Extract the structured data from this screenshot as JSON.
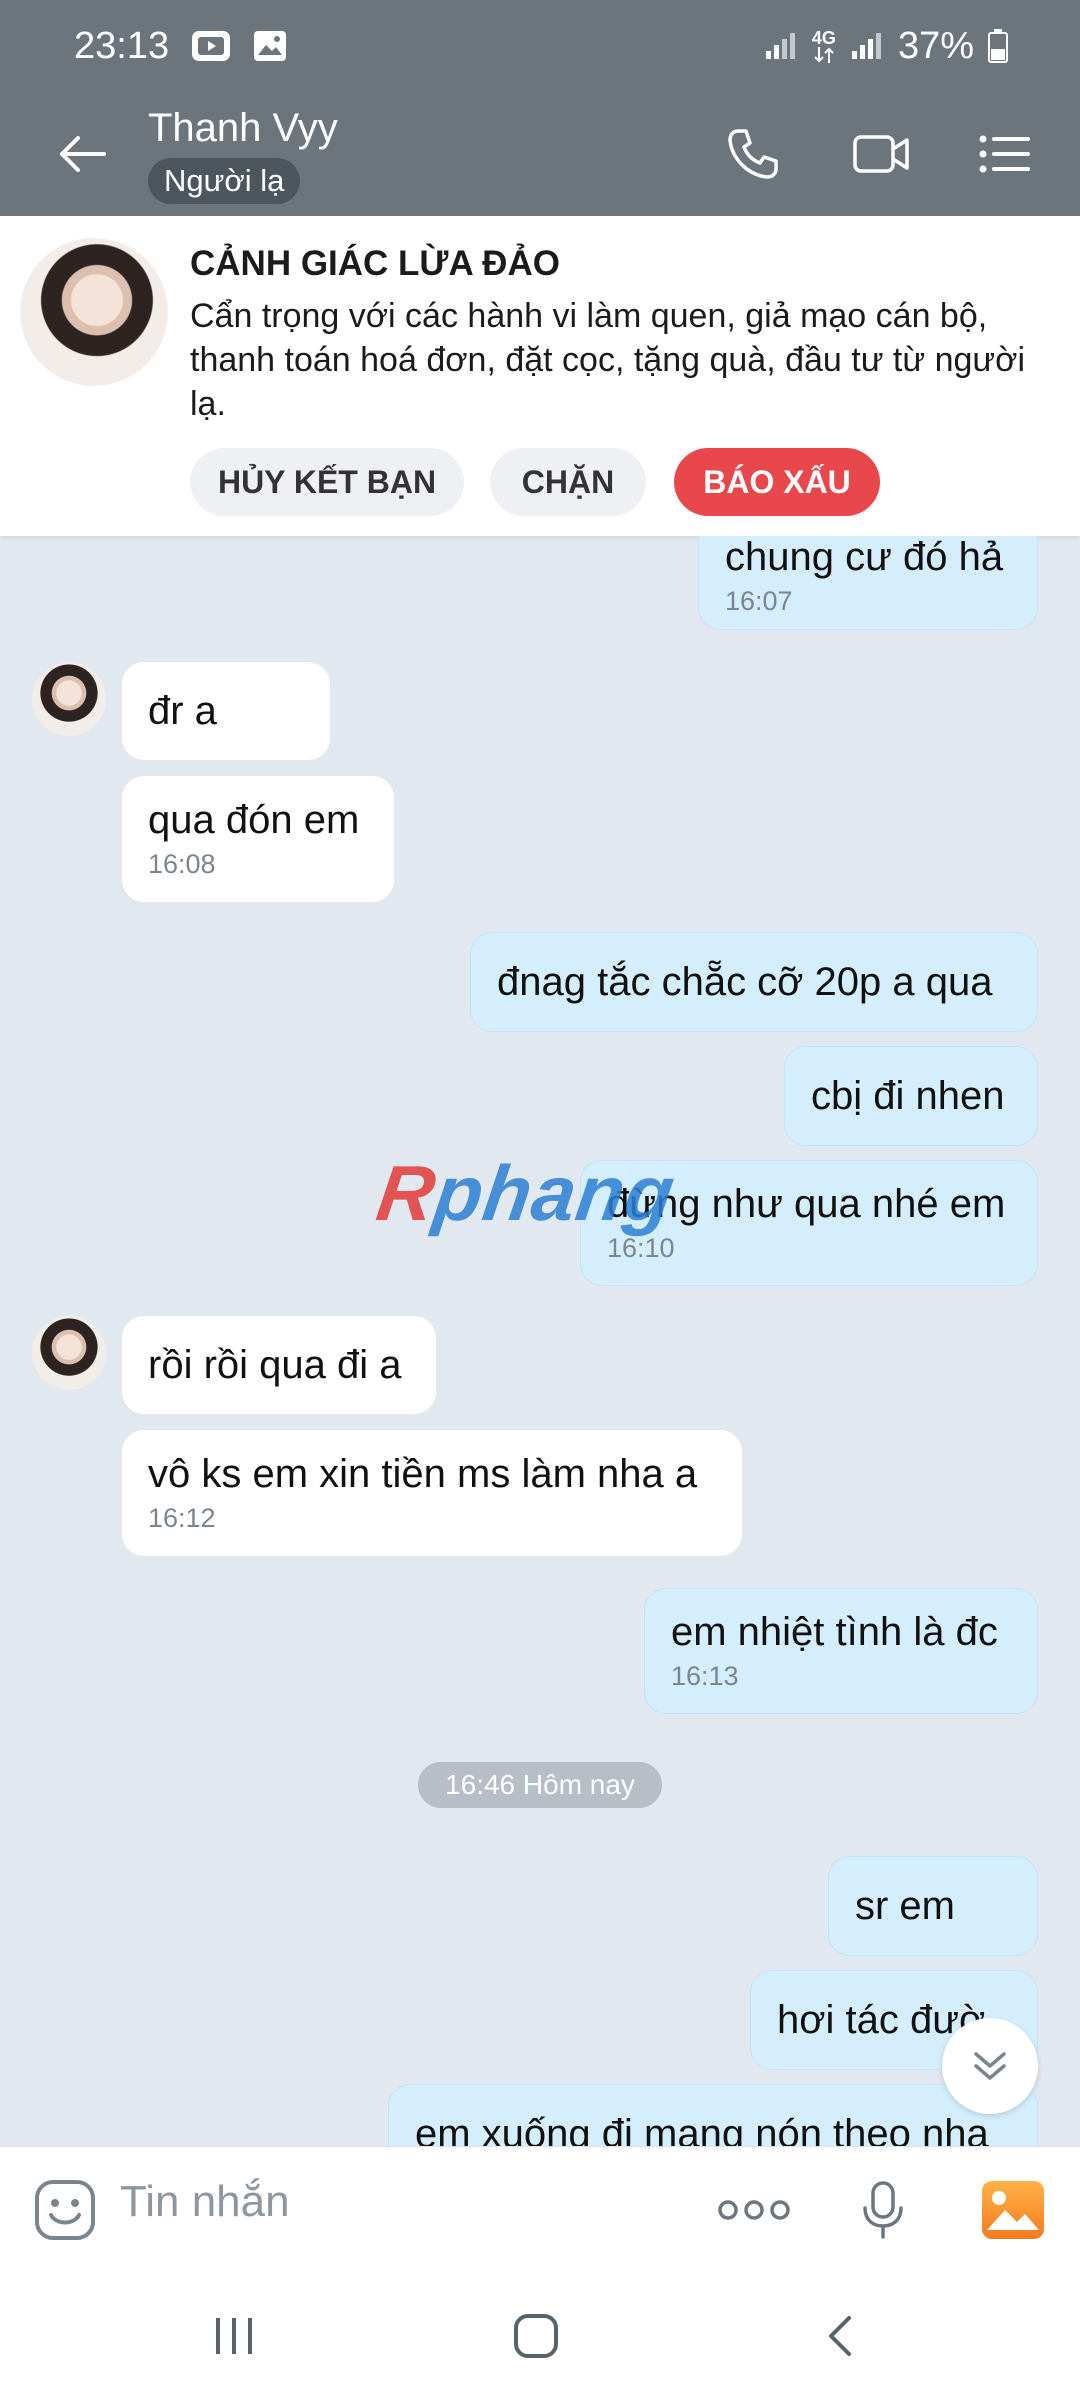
{
  "status_bar": {
    "time": "23:13",
    "network": "4G",
    "battery": "37%"
  },
  "header": {
    "name": "Thanh Vyy",
    "tag": "Người lạ"
  },
  "warning": {
    "title": "CẢNH GIÁC LỪA ĐẢO",
    "text": "Cẩn trọng với các hành vi làm quen, giả mạo cán bộ, thanh toán hoá đơn, đặt cọc, tặng quà, đầu tư từ người lạ.",
    "unfriend_label": "HỦY KẾT BẠN",
    "block_label": "CHẶN",
    "report_label": "BÁO XẤU",
    "report_color": "#e8474c"
  },
  "messages": [
    {
      "text": "chung cư đó hả",
      "time": "16:07"
    },
    {
      "text": "đr a"
    },
    {
      "text": "qua đón em",
      "time": "16:08"
    },
    {
      "text": "đnag tắc chẵc cỡ 20p a qua"
    },
    {
      "text": "cbị đi nhen"
    },
    {
      "text": "đừng như qua nhé em",
      "time": "16:10"
    },
    {
      "text": "rồi rồi qua đi a"
    },
    {
      "text": "vô ks em xin tiền ms làm nha a",
      "time": "16:12"
    },
    {
      "text": "em nhiệt tình là đc",
      "time": "16:13"
    },
    {
      "text": "sr em"
    },
    {
      "text": "hơi tác đườ"
    },
    {
      "text": "em xuống đi mang nón theo nha"
    }
  ],
  "date_separator": "16:46 Hôm nay",
  "watermark": {
    "first": "R",
    "rest": "phang"
  },
  "composer": {
    "placeholder": "Tin nhắn"
  },
  "colors": {
    "header_bg": "#6c757c",
    "chat_bg": "#e2e8ef",
    "outgoing_bubble": "#d5eefd",
    "incoming_bubble": "#ffffff"
  }
}
